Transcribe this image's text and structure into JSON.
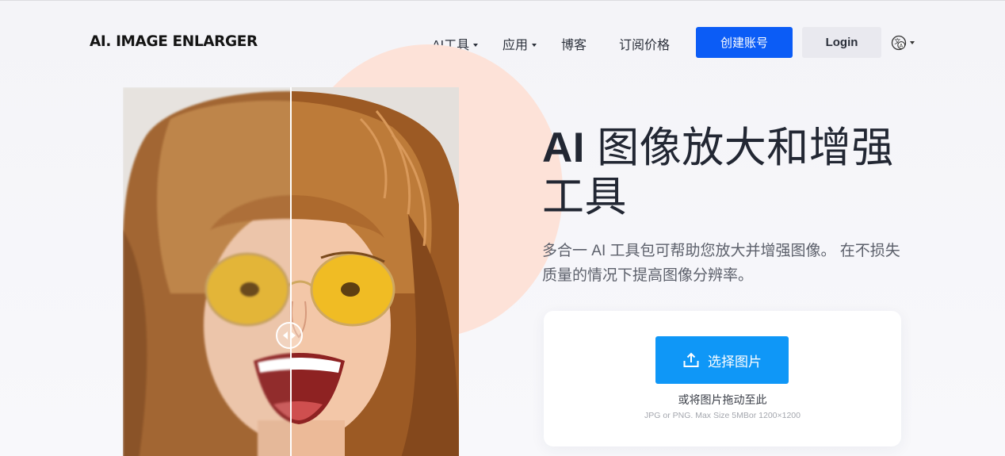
{
  "header": {
    "logo": "AI. IMAGE ENLARGER",
    "nav": {
      "ai_tools": "AI工具",
      "apps": "应用",
      "blog": "博客",
      "pricing": "订阅价格"
    },
    "signup_label": "创建账号",
    "login_label": "Login",
    "language_icon": "translate-icon"
  },
  "hero": {
    "title_ai": "AI",
    "title_rest": " 图像放大和增强工具",
    "description": "多合一 AI 工具包可帮助您放大并增强图像。 在不损失质量的情况下提高图像分辨率。"
  },
  "upload": {
    "button_label": "选择图片",
    "button_icon": "upload-icon",
    "drop_hint": "或将图片拖动至此",
    "file_hint": "JPG or PNG. Max Size 5MBor 1200×1200"
  },
  "compare": {
    "handle_icon": "compare-arrows-icon"
  },
  "colors": {
    "primary": "#0b5cf6",
    "upload": "#0f97f7",
    "accent_circle": "#fde2d8",
    "title_text": "#222733"
  }
}
